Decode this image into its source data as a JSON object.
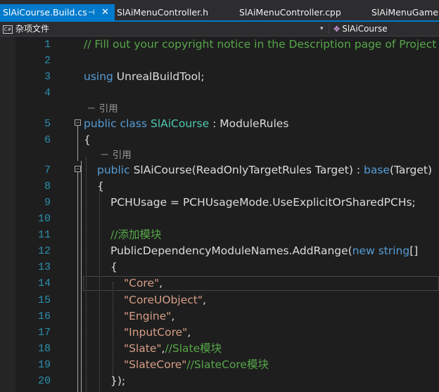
{
  "tabs": [
    {
      "label": "SlAiCourse.Build.cs",
      "pin_icon": "pin-icon",
      "close_icon": "close-icon",
      "active": true
    },
    {
      "label": "SlAiMenuController.h",
      "active": false
    },
    {
      "label": "SlAiMenuController.cpp",
      "active": false
    },
    {
      "label": "SlAiMenuGameM",
      "active": false
    }
  ],
  "navbar": {
    "left_label": "杂项文件",
    "left_icon": "file-icon",
    "dropdown_icon": "chevron-down-icon",
    "right_label": "SlAiCourse",
    "right_icon": "class-icon"
  },
  "colors": {
    "accent": "#007acc",
    "keyword": "#569cd6",
    "type": "#4ec9b0",
    "string": "#d69d85",
    "comment": "#57a64a",
    "line_number": "#2b91af"
  },
  "editor": {
    "line_numbers": [
      "1",
      "2",
      "3",
      "4",
      "5",
      "6",
      "7",
      "8",
      "9",
      "10",
      "11",
      "12",
      "13",
      "14",
      "15",
      "16",
      "17",
      "18",
      "19",
      "20"
    ],
    "current_line": "14",
    "codelens_label": "引用",
    "codelens_prefix": "－",
    "code": {
      "l1": "// Fill out your copyright notice in the Description page of Project Settings.",
      "l3a": "using",
      "l3b": " UnrealBuildTool;",
      "l5a": "public",
      "l5b": " class ",
      "l5c": "SlAiCourse",
      "l5d": " : ModuleRules",
      "l6": "{",
      "l7a": "public",
      "l7b": " SlAiCourse(ReadOnlyTargetRules Target) : ",
      "l7c": "base",
      "l7d": "(Target)",
      "l8": "{",
      "l9": "PCHUsage = PCHUsageMode.UseExplicitOrSharedPCHs;",
      "l11": "//添加模块",
      "l12a": "PublicDependencyModuleNames.AddRange(",
      "l12b": "new",
      "l12c": " string",
      "l12d": "[]",
      "l13": "{",
      "l14a": "\"Core\"",
      "l14b": ",",
      "l15a": "\"CoreUObject\"",
      "l15b": ",",
      "l16a": "\"Engine\"",
      "l16b": ",",
      "l17a": "\"InputCore\"",
      "l17b": ",",
      "l18a": "\"Slate\"",
      "l18b": ",",
      "l18c": "//Slate模块",
      "l19a": "\"SlateCore\"",
      "l19b": "//SlateCore模块",
      "l20": "});"
    }
  }
}
